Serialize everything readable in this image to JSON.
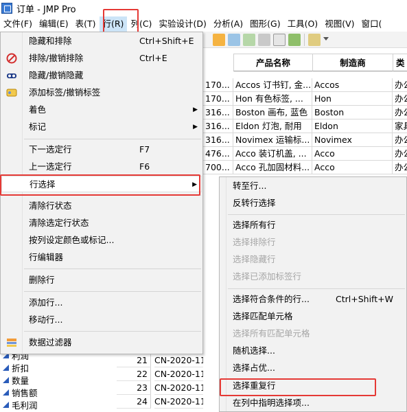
{
  "window": {
    "title": "订单 - JMP Pro"
  },
  "menubar": {
    "items": [
      "文件(F)",
      "编辑(E)",
      "表(T)",
      "行(R)",
      "列(C)",
      "实验设计(D)",
      "分析(A)",
      "图形(G)",
      "工具(O)",
      "视图(V)",
      "窗口("
    ],
    "active_index": 3
  },
  "table": {
    "headers": [
      "产品名称",
      "制造商",
      "类"
    ],
    "rows": [
      {
        "id": "170...",
        "name": "Accos 订书钉, 金...",
        "maker": "Accos",
        "cat": "办公"
      },
      {
        "id": "170...",
        "name": "Hon 有色标签, ...",
        "maker": "Hon",
        "cat": "办公"
      },
      {
        "id": "316...",
        "name": "Boston 画布, 蓝色",
        "maker": "Boston",
        "cat": "办公"
      },
      {
        "id": "316...",
        "name": "Eldon 灯泡, 耐用",
        "maker": "Eldon",
        "cat": "家具"
      },
      {
        "id": "316...",
        "name": "Novimex 运输标...",
        "maker": "Novimex",
        "cat": "办公"
      },
      {
        "id": "476...",
        "name": "Acco 装订机盖, ...",
        "maker": "Acco",
        "cat": "办公"
      },
      {
        "id": "700...",
        "name": "Acco 孔加固材料...",
        "maker": "Acco",
        "cat": "办公"
      }
    ]
  },
  "columns_panel": {
    "items": [
      "利润",
      "折扣",
      "数量",
      "销售额",
      "毛利润"
    ]
  },
  "lower_rows": [
    {
      "num": "21",
      "val": "CN-2020-11"
    },
    {
      "num": "22",
      "val": "CN-2020-11"
    },
    {
      "num": "23",
      "val": "CN-2020-11"
    },
    {
      "num": "24",
      "val": "CN-2020-11"
    }
  ],
  "row_menu": {
    "items": [
      {
        "label": "隐藏和排除",
        "shortcut": "Ctrl+Shift+E"
      },
      {
        "label": "排除/撤销排除",
        "shortcut": "Ctrl+E",
        "icon": "exclude-icon"
      },
      {
        "label": "隐藏/撤销隐藏",
        "shortcut": "",
        "icon": "hide-icon"
      },
      {
        "label": "添加标签/撤销标签",
        "shortcut": "",
        "icon": "label-icon"
      },
      {
        "label": "着色",
        "submenu": true
      },
      {
        "label": "标记",
        "submenu": true
      },
      {
        "label": "下一选定行",
        "shortcut": "F7"
      },
      {
        "label": "上一选定行",
        "shortcut": "F6"
      },
      {
        "label": "行选择",
        "submenu": true
      },
      {
        "label": "清除行状态"
      },
      {
        "label": "清除选定行状态"
      },
      {
        "label": "按列设定颜色或标记..."
      },
      {
        "label": "行编辑器"
      },
      {
        "label": "删除行"
      },
      {
        "label": "添加行..."
      },
      {
        "label": "移动行..."
      },
      {
        "label": "数据过滤器",
        "icon": "data-filter-icon"
      }
    ]
  },
  "row_select_submenu": {
    "items": [
      {
        "label": "转至行..."
      },
      {
        "label": "反转行选择"
      },
      {
        "label": "选择所有行"
      },
      {
        "label": "选择排除行",
        "disabled": true
      },
      {
        "label": "选择隐藏行",
        "disabled": true
      },
      {
        "label": "选择已添加标签行",
        "disabled": true
      },
      {
        "label": "选择符合条件的行...",
        "shortcut": "Ctrl+Shift+W"
      },
      {
        "label": "选择匹配单元格"
      },
      {
        "label": "选择所有匹配单元格",
        "disabled": true
      },
      {
        "label": "随机选择..."
      },
      {
        "label": "选择占优..."
      },
      {
        "label": "选择重复行"
      },
      {
        "label": "在列中指明选择项..."
      }
    ]
  },
  "colors": {
    "highlight_red": "#e53935",
    "active_menu": "#cce4f7"
  }
}
